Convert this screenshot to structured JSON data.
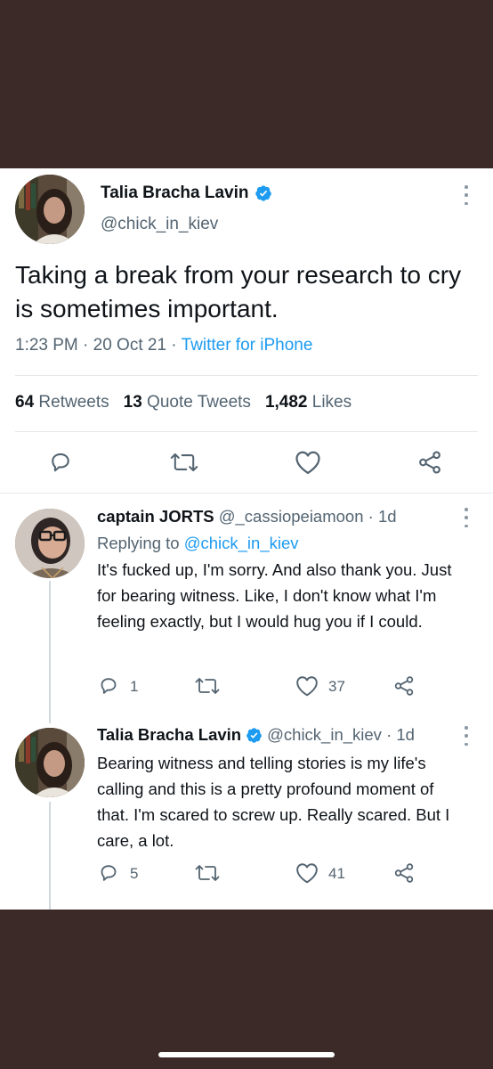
{
  "main_tweet": {
    "author_name": "Talia Bracha Lavin",
    "author_handle": "@chick_in_kiev",
    "text": "Taking a break from your research to cry is sometimes important.",
    "time": "1:23 PM · 20 Oct 21 · ",
    "source": "Twitter for iPhone",
    "stats": {
      "retweets_count": "64",
      "retweets_label": "Retweets",
      "quotes_count": "13",
      "quotes_label": "Quote Tweets",
      "likes_count": "1,482",
      "likes_label": "Likes"
    }
  },
  "replies": [
    {
      "author_name": "captain JORTS",
      "author_handle": "@_cassiopeiamoon",
      "age": "· 1d",
      "replying_to_label": "Replying to",
      "replying_to_handle": "@chick_in_kiev",
      "text": "It's fucked up, I'm sorry. And also thank you. Just for bearing witness. Like, I don't know what I'm feeling exactly, but I would hug you if I could.",
      "reply_count": "1",
      "like_count": "37"
    },
    {
      "author_name": "Talia Bracha Lavin",
      "author_handle": "@chick_in_kiev",
      "age": "· 1d",
      "text": "Bearing witness and telling stories is my life's calling and this is a pretty profound moment of that. I'm scared to screw up. Really scared. But I care, a lot.",
      "reply_count": "5",
      "like_count": "41"
    }
  ],
  "colors": {
    "background_band": "#3b2a28",
    "accent": "#1d9bf0",
    "text_primary": "#0f1419",
    "text_secondary": "#536471",
    "icon": "#536471"
  },
  "icons": {
    "verified": "verified-badge-icon",
    "reply": "reply-icon",
    "retweet": "retweet-icon",
    "like": "heart-icon",
    "share": "share-icon",
    "more": "more-dots-icon"
  }
}
